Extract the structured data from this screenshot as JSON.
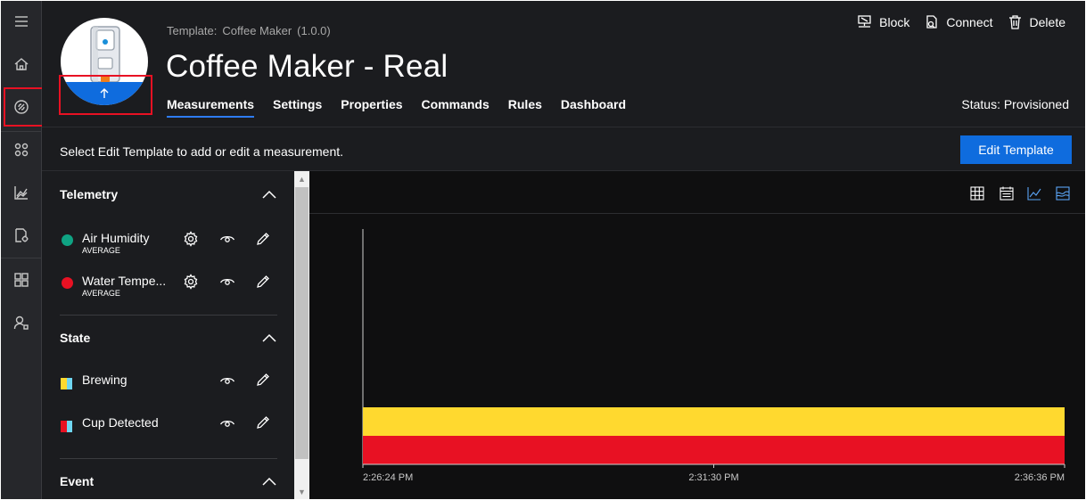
{
  "nav": {
    "items": [
      {
        "name": "menu",
        "icon": "hamburger-icon"
      },
      {
        "name": "home",
        "icon": "home-icon"
      },
      {
        "name": "devices",
        "icon": "device-explorer-icon",
        "selected": true
      },
      {
        "name": "apps",
        "icon": "apps-icon"
      },
      {
        "name": "analytics",
        "icon": "analytics-icon"
      },
      {
        "name": "jobs",
        "icon": "jobs-icon"
      },
      {
        "name": "dashboard",
        "icon": "dashboard-icon"
      },
      {
        "name": "administration",
        "icon": "user-admin-icon"
      }
    ]
  },
  "header": {
    "template_label": "Template:",
    "template_name": "Coffee Maker",
    "template_version": "(1.0.0)",
    "device_title": "Coffee Maker - Real",
    "status": "Status: Provisioned",
    "actions": [
      {
        "label": "Block",
        "icon": "block-icon"
      },
      {
        "label": "Connect",
        "icon": "connect-icon"
      },
      {
        "label": "Delete",
        "icon": "delete-icon"
      }
    ],
    "tabs": [
      {
        "label": "Measurements",
        "active": true
      },
      {
        "label": "Settings"
      },
      {
        "label": "Properties"
      },
      {
        "label": "Commands"
      },
      {
        "label": "Rules"
      },
      {
        "label": "Dashboard"
      }
    ]
  },
  "infobar": {
    "text": "Select Edit Template to add or edit a measurement.",
    "button": "Edit Template",
    "accent": "#0f6cde"
  },
  "panel": {
    "telemetry": {
      "title": "Telemetry",
      "items": [
        {
          "name": "Air Humidity",
          "aggregate": "AVERAGE",
          "color": "#0fa383"
        },
        {
          "name": "Water Tempe...",
          "aggregate": "AVERAGE",
          "color": "#e81123"
        }
      ]
    },
    "state": {
      "title": "State",
      "items": [
        {
          "name": "Brewing",
          "colors": [
            "#ffd92f",
            "#6fd6f2"
          ]
        },
        {
          "name": "Cup Detected",
          "colors": [
            "#e81123",
            "#6fd6f2"
          ]
        }
      ]
    },
    "event": {
      "title": "Event"
    }
  },
  "chart_tools": [
    "grid-view-icon",
    "calendar-icon",
    "line-chart-icon",
    "area-chart-icon"
  ],
  "chart_data": {
    "type": "bar",
    "x_ticks": [
      "2:26:24 PM",
      "2:31:30 PM",
      "2:36:36 PM"
    ],
    "series": [
      {
        "name": "Brewing",
        "color": "#ffd92f"
      },
      {
        "name": "Cup Detected",
        "color": "#e81123"
      }
    ],
    "grid": false
  }
}
